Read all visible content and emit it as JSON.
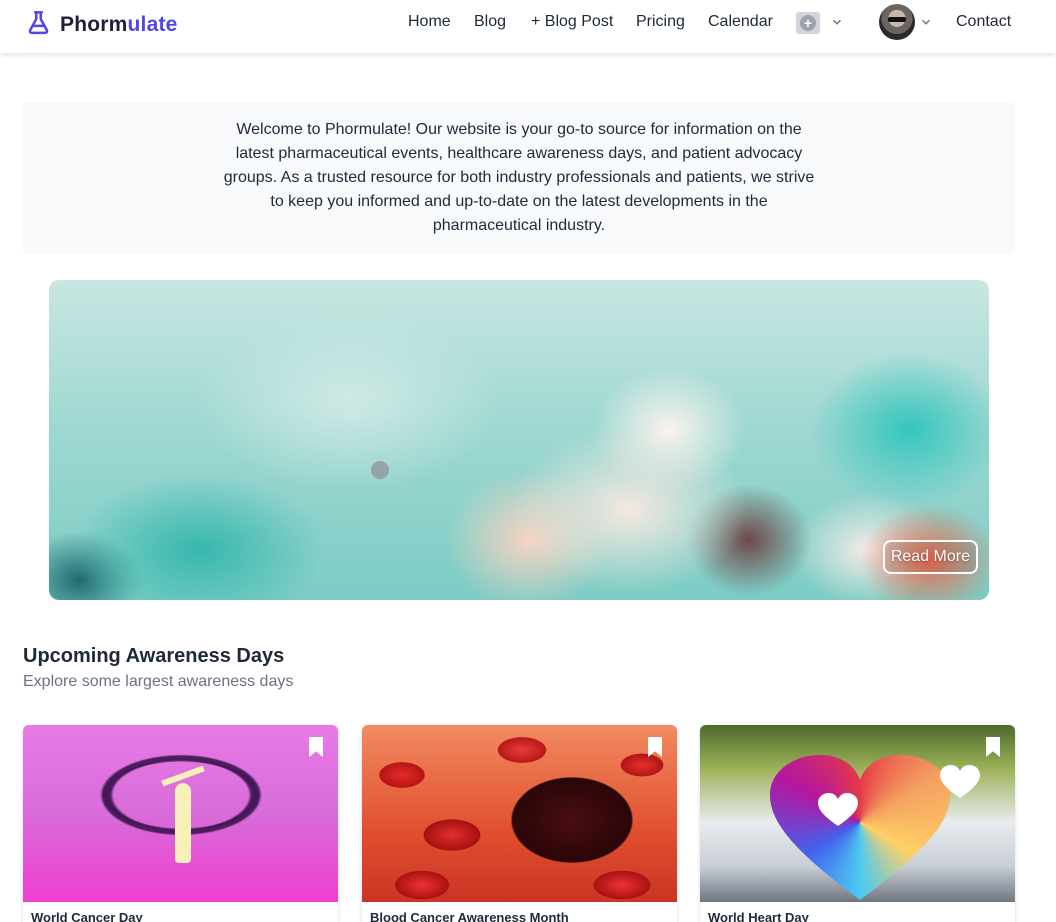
{
  "brand": {
    "name_part1": "Phorm",
    "name_part2": "ulate"
  },
  "nav": {
    "home": "Home",
    "blog": "Blog",
    "blog_post": "+ Blog Post",
    "pricing": "Pricing",
    "calendar": "Calendar",
    "contact": "Contact"
  },
  "welcome": {
    "text": "Welcome to Phormulate! Our website is your go-to source for information on the latest pharmaceutical events, healthcare awareness days, and patient advocacy groups. As a trusted resource for both industry professionals and patients, we strive to keep you informed and up-to-date on the latest developments in the pharmaceutical industry."
  },
  "hero": {
    "read_more": "Read More"
  },
  "awareness": {
    "title": "Upcoming Awareness Days",
    "subtitle": "Explore some largest awareness days",
    "cards": [
      {
        "title": "World Cancer Day"
      },
      {
        "title": "Blood Cancer Awareness Month"
      },
      {
        "title": "World Heart Day"
      }
    ]
  },
  "colors": {
    "brand_accent": "#4f46e5",
    "brand_dark": "#1f1f3a"
  },
  "icons": [
    "flask-icon",
    "plus-circle-icon",
    "chevron-down-icon",
    "bookmark-icon"
  ]
}
